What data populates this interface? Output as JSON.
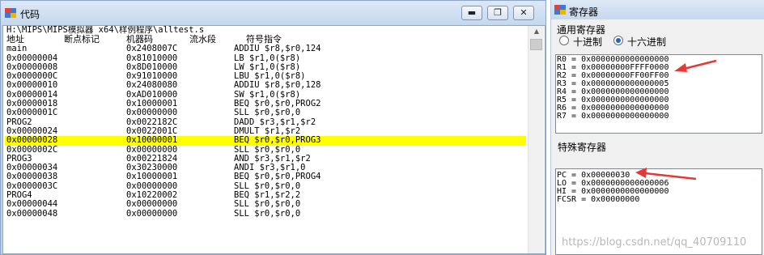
{
  "code_window": {
    "title": "代码",
    "minimize_glyph": "▬",
    "restore_glyph": "❐",
    "close_glyph": "✕",
    "path": "H:\\MIPS\\MIPS模拟器 x64\\样例程序\\alltest.s",
    "columns": [
      "地址",
      "断点标记",
      "机器码",
      "流水段",
      "符号指令"
    ],
    "rows": [
      {
        "addr": "main",
        "code": "0x2408007C",
        "instr": "ADDIU $r8,$r0,124"
      },
      {
        "addr": "0x00000004",
        "code": "0x81010000",
        "instr": "LB $r1,0($r8)"
      },
      {
        "addr": "0x00000008",
        "code": "0x8D010000",
        "instr": "LW $r1,0($r8)"
      },
      {
        "addr": "0x0000000C",
        "code": "0x91010000",
        "instr": "LBU $r1,0($r8)"
      },
      {
        "addr": "0x00000010",
        "code": "0x24080080",
        "instr": "ADDIU $r8,$r0,128"
      },
      {
        "addr": "0x00000014",
        "code": "0xAD010000",
        "instr": "SW $r1,0($r8)"
      },
      {
        "addr": "0x00000018",
        "code": "0x10000001",
        "instr": "BEQ $r0,$r0,PROG2"
      },
      {
        "addr": "0x0000001C",
        "code": "0x00000000",
        "instr": "SLL $r0,$r0,0"
      },
      {
        "addr": "PROG2",
        "code": "0x0022182C",
        "instr": "DADD $r3,$r1,$r2"
      },
      {
        "addr": "0x00000024",
        "code": "0x0022001C",
        "instr": "DMULT $r1,$r2"
      },
      {
        "addr": "0x00000028",
        "code": "0x10000001",
        "instr": "BEQ $r0,$r0,PROG3",
        "selected": true
      },
      {
        "addr": "0x0000002C",
        "code": "0x00000000",
        "instr": "SLL $r0,$r0,0"
      },
      {
        "addr": "PROG3",
        "code": "0x00221824",
        "instr": "AND $r3,$r1,$r2"
      },
      {
        "addr": "0x00000034",
        "code": "0x30230000",
        "instr": "ANDI $r3,$r1,0"
      },
      {
        "addr": "0x00000038",
        "code": "0x10000001",
        "instr": "BEQ $r0,$r0,PROG4"
      },
      {
        "addr": "0x0000003C",
        "code": "0x00000000",
        "instr": "SLL $r0,$r0,0"
      },
      {
        "addr": "PROG4",
        "code": "0x10220002",
        "instr": "BEQ $r1,$r2,2"
      },
      {
        "addr": "0x00000044",
        "code": "0x00000000",
        "instr": "SLL $r0,$r0,0"
      },
      {
        "addr": "0x00000048",
        "code": "0x00000000",
        "instr": "SLL $r0,$r0,0"
      }
    ]
  },
  "register_window": {
    "title": "寄存器",
    "gpr_label": "通用寄存器",
    "radio_decimal": "十进制",
    "radio_hex": "十六进制",
    "selected_radio": "十六进制",
    "gpr_lines": [
      "R0 = 0x0000000000000000",
      "R1 = 0x00000000FFFF0000",
      "R2 = 0x00000000FF00FF00",
      "R3 = 0x0000000000000005",
      "R4 = 0x0000000000000000",
      "R5 = 0x0000000000000000",
      "R6 = 0x0000000000000000",
      "R7 = 0x0000000000000000"
    ],
    "spr_label": "特殊寄存器",
    "spr_lines": [
      "PC = 0x00000030",
      "LO = 0x0000000000000006",
      "HI = 0x0000000000000000",
      "FCSR = 0x00000000"
    ]
  },
  "colors": {
    "selection": "#ffff00",
    "annotation_arrow": "#e53935",
    "title_bar": "#c6d8ee"
  },
  "watermark": "https://blog.csdn.net/qq_40709110"
}
